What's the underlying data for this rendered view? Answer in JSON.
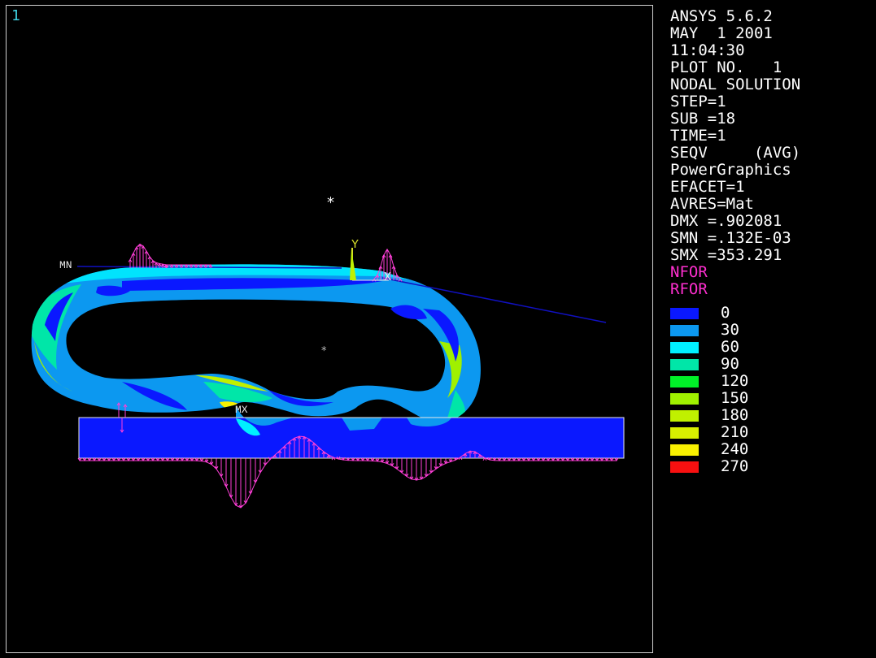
{
  "window": {
    "number": "1"
  },
  "colors": {
    "background": "#000000",
    "frame": "#d0d0d0",
    "info_text": "#ffffff",
    "window_number": "#3fd0e0",
    "force_text": "#ff2fd0",
    "force_arrows": "#ff3fd8",
    "trace_line": "#1010c0",
    "axis_label": "#d8e02a"
  },
  "info": {
    "lines": [
      "ANSYS 5.6.2",
      "MAY  1 2001",
      "11:04:30",
      "PLOT NO.   1",
      "NODAL SOLUTION",
      "STEP=1",
      "SUB =18",
      "TIME=1",
      "SEQV     (AVG)",
      "PowerGraphics",
      "EFACET=1",
      "AVRES=Mat",
      "DMX =.902081",
      "SMN =.132E-03",
      "SMX =353.291"
    ],
    "force_labels": [
      "NFOR",
      "RFOR"
    ]
  },
  "legend": [
    {
      "value": "0",
      "color": "#0a18ff"
    },
    {
      "value": "30",
      "color": "#0c98f0"
    },
    {
      "value": "60",
      "color": "#00f0ff"
    },
    {
      "value": "90",
      "color": "#00e6a8"
    },
    {
      "value": "120",
      "color": "#00f028"
    },
    {
      "value": "150",
      "color": "#a0f000"
    },
    {
      "value": "180",
      "color": "#c0f000"
    },
    {
      "value": "210",
      "color": "#d8f000"
    },
    {
      "value": "240",
      "color": "#f8f000"
    },
    {
      "value": "270",
      "color": "#f81010"
    }
  ],
  "plot_labels": {
    "min_marker": "MN",
    "max_marker": "MX",
    "axis_y": "Y",
    "axis_x": "X",
    "focus_mark": "*",
    "center_mark": "*"
  }
}
